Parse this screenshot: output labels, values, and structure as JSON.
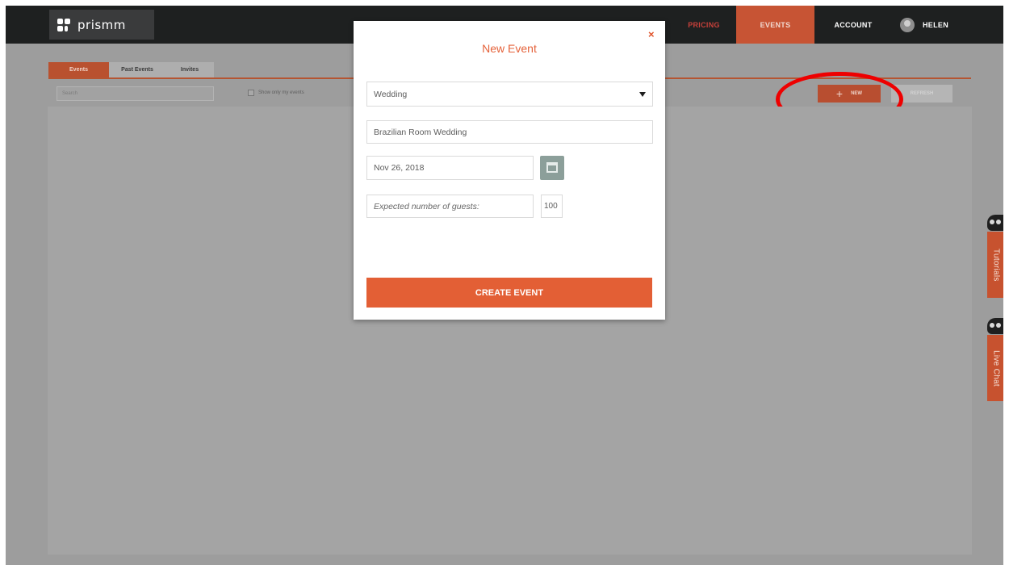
{
  "app": {
    "brand": "prismm"
  },
  "nav": {
    "pricing": "PRICING",
    "events": "EVENTS",
    "account": "ACCOUNT",
    "user": "HELEN"
  },
  "tabs": [
    {
      "label": "Events",
      "active": true
    },
    {
      "label": "Past Events",
      "active": false
    },
    {
      "label": "Invites",
      "active": false
    }
  ],
  "toolbar": {
    "search_placeholder": "Search",
    "show_mine_label": "Show only my events",
    "new_label": "NEW",
    "refresh_label": "REFRESH"
  },
  "side_widgets": {
    "tutorials": "Tutorials",
    "live_chat": "Live Chat"
  },
  "modal": {
    "title": "New Event",
    "close_symbol": "×",
    "event_type": "Wedding",
    "event_name": "Brazilian Room Wedding",
    "event_date": "Nov 26, 2018",
    "guests_label": "Expected number of guests:",
    "guests_value": "100",
    "submit_label": "CREATE EVENT"
  },
  "colors": {
    "accent": "#e35f35",
    "nav_bg": "#1e2020",
    "overlay_gray": "#9d9d9d",
    "highlight_ring": "#ee0000"
  },
  "icons": [
    "prismm-logo-icon",
    "user-avatar-icon",
    "plus-icon",
    "calendar-icon",
    "dropdown-caret-icon",
    "close-icon",
    "owl-mascot-icon"
  ]
}
